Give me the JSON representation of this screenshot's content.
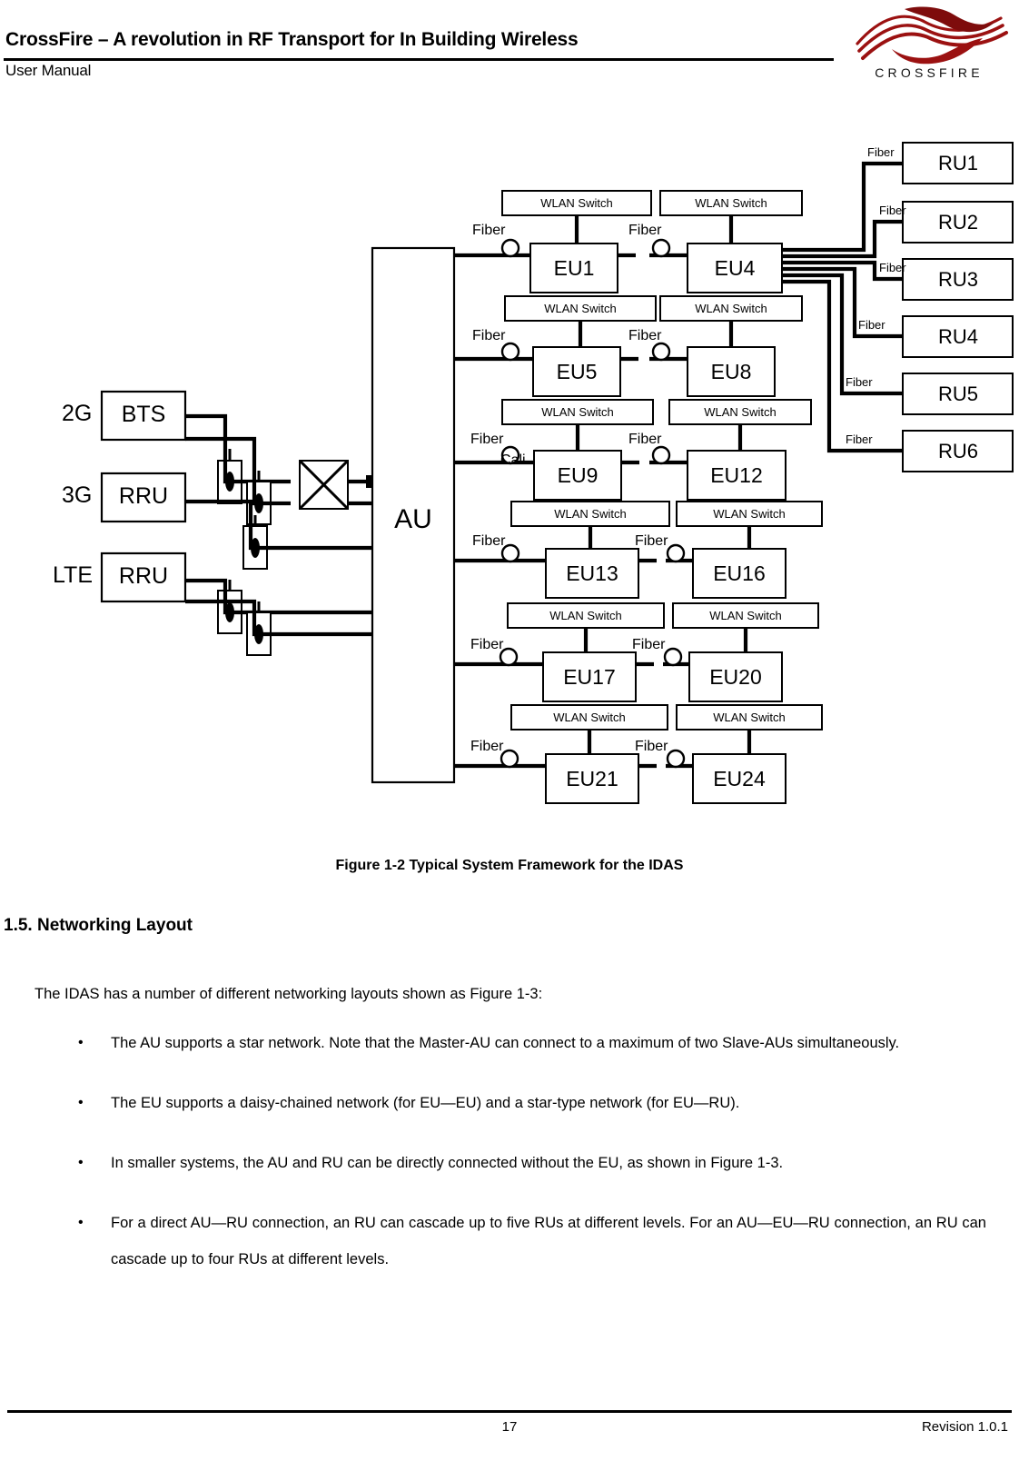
{
  "header": {
    "title": "CrossFire – A revolution in RF Transport for In Building Wireless",
    "subtitle": "User Manual",
    "logo_wordmark": "CROSSFIRE",
    "logo_color": "#9B1111",
    "logo_icon": "crossfire-wave-logo"
  },
  "figure": {
    "caption": "Figure 1-2 Typical System Framework for the IDAS",
    "sources": [
      {
        "tech": "2G",
        "device": "BTS"
      },
      {
        "tech": "3G",
        "device": "RRU"
      },
      {
        "tech": "LTE",
        "device": "RRU"
      }
    ],
    "au": {
      "label": "AU"
    },
    "fiber_label": "Fiber",
    "wlan_switch_label": "WLAN Switch",
    "stray_text": "Cali",
    "eu_rows": [
      {
        "left": "EU1",
        "right": "EU4"
      },
      {
        "left": "EU5",
        "right": "EU8"
      },
      {
        "left": "EU9",
        "right": "EU12"
      },
      {
        "left": "EU13",
        "right": "EU16"
      },
      {
        "left": "EU17",
        "right": "EU20"
      },
      {
        "left": "EU21",
        "right": "EU24"
      }
    ],
    "ru_units": [
      "RU1",
      "RU2",
      "RU3",
      "RU4",
      "RU5",
      "RU6"
    ]
  },
  "body": {
    "section_heading": "1.5. Networking Layout",
    "intro": "The IDAS has a number of different networking layouts shown as Figure 1-3:",
    "bullet_marker": "•",
    "bullets": [
      "The AU supports a star network. Note that the Master-AU can connect to a maximum of two Slave-AUs simultaneously.",
      "The EU supports a daisy-chained network (for EU—EU) and a star-type network (for EU—RU).",
      "In smaller systems, the AU and RU can be directly connected without the EU, as shown in Figure 1-3.",
      "For a direct AU—RU connection, an RU can cascade up to five RUs at different levels. For an AU—EU—RU connection, an RU can cascade up to four RUs at different levels."
    ]
  },
  "footer": {
    "page_number": "17",
    "revision": "Revision 1.0.1"
  }
}
